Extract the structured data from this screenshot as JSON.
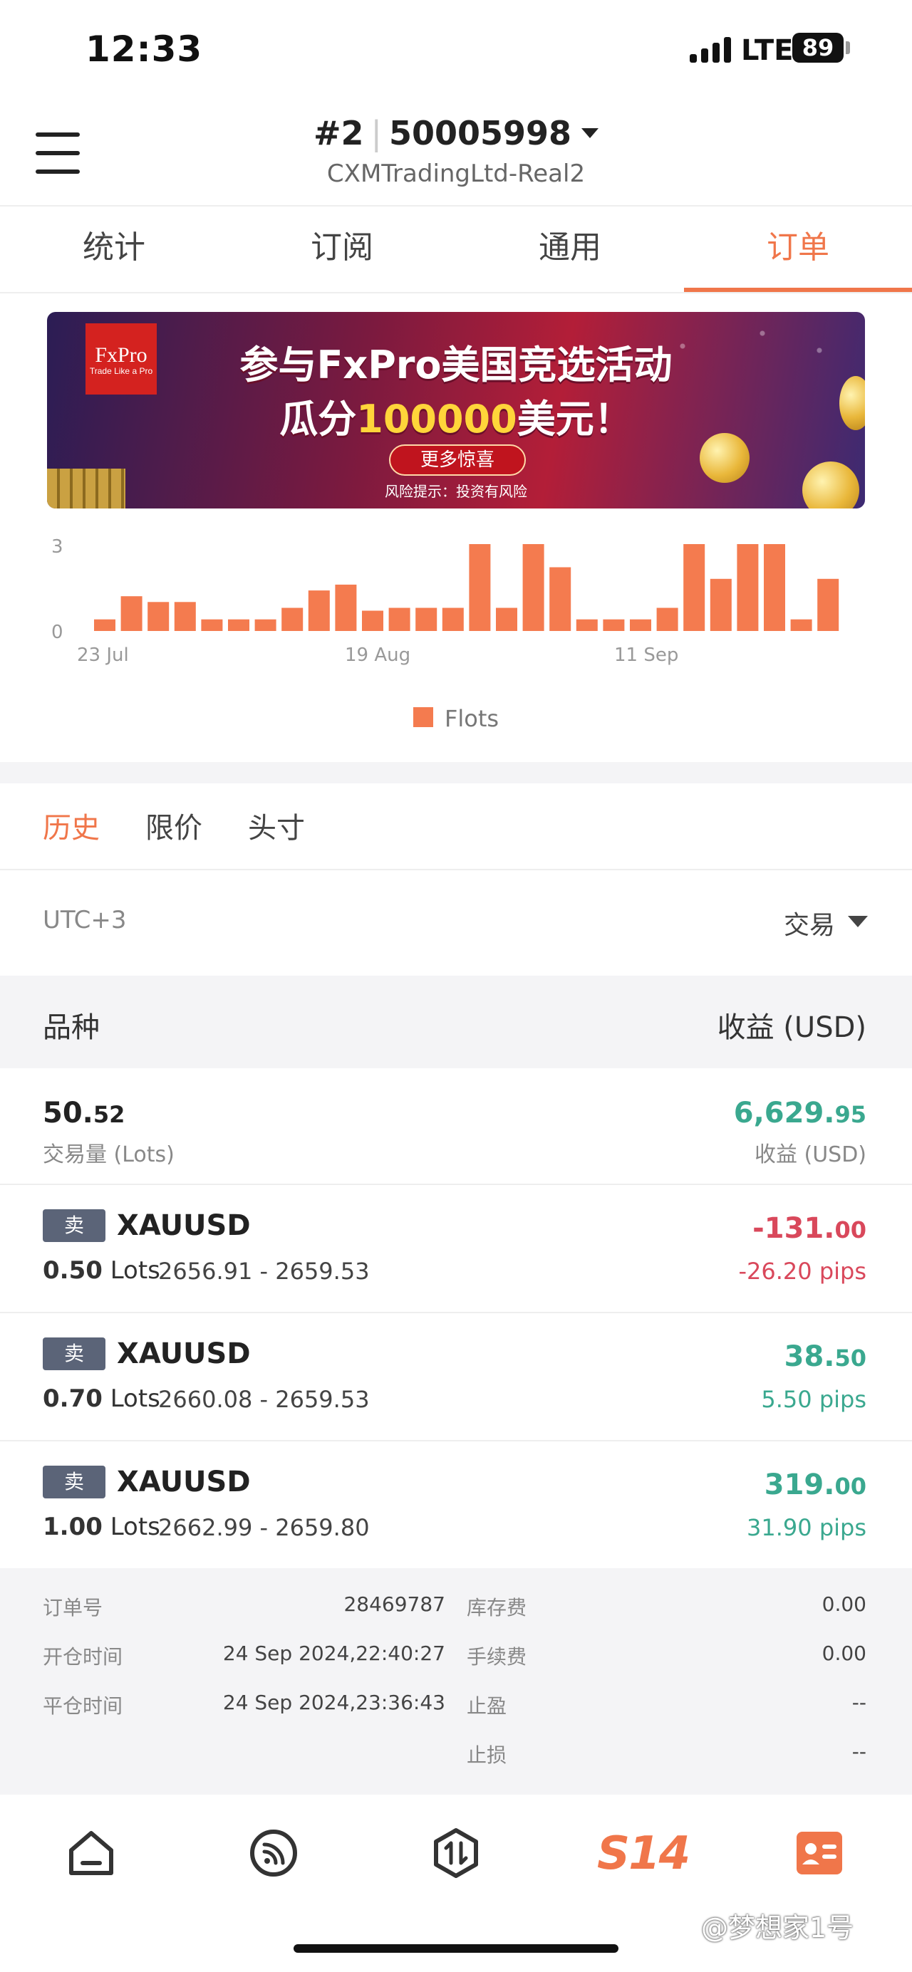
{
  "status_bar": {
    "time": "12:33",
    "network": "LTE",
    "battery": "89"
  },
  "header": {
    "account_index": "#2",
    "account_number": "50005998",
    "server": "CXMTradingLtd-Real2"
  },
  "tabs": [
    {
      "label": "统计"
    },
    {
      "label": "订阅"
    },
    {
      "label": "通用"
    },
    {
      "label": "订单"
    }
  ],
  "banner": {
    "logo": "FxPro",
    "logo_tagline": "Trade Like a Pro",
    "line1": "参与FxPro美国竞选活动",
    "line2_prefix": "瓜分",
    "line2_highlight": "100000",
    "line2_suffix": "美元！",
    "button": "更多惊喜",
    "risk": "风险提示：投资有风险"
  },
  "chart_data": {
    "type": "bar",
    "y_ticks": [
      "3",
      "0"
    ],
    "ylim": [
      0,
      3
    ],
    "x_ticks": [
      "23 Jul",
      "19 Aug",
      "11 Sep"
    ],
    "values": [
      0.4,
      1.2,
      1.0,
      1.0,
      0.4,
      0.4,
      0.4,
      0.8,
      1.4,
      1.6,
      0.7,
      0.8,
      0.8,
      0.8,
      3.0,
      0.8,
      3.0,
      2.2,
      0.4,
      0.4,
      0.4,
      0.8,
      3.0,
      1.8,
      3.0,
      3.0,
      0.4,
      1.8
    ],
    "series": [
      {
        "name": "Flots",
        "color": "#f47b4f"
      }
    ],
    "legend": "Flots"
  },
  "subtabs": [
    {
      "label": "历史"
    },
    {
      "label": "限价"
    },
    {
      "label": "头寸"
    }
  ],
  "filter": {
    "timezone": "UTC+3",
    "type": "交易"
  },
  "table_header": {
    "left": "品种",
    "right": "收益 (USD)"
  },
  "summary": {
    "volume_int": "50.",
    "volume_dec": "52",
    "volume_label": "交易量 (Lots)",
    "profit_int": "6,629.",
    "profit_dec": "95",
    "profit_label": "收益 (USD)"
  },
  "trades": [
    {
      "side": "卖",
      "symbol": "XAUUSD",
      "lots": "0.50",
      "lots_unit": "Lots",
      "prices": "2656.91 - 2659.53",
      "profit_int": "-131.",
      "profit_dec": "00",
      "pips": "-26.20 pips"
    },
    {
      "side": "卖",
      "symbol": "XAUUSD",
      "lots": "0.70",
      "lots_unit": "Lots",
      "prices": "2660.08 - 2659.53",
      "profit_int": "38.",
      "profit_dec": "50",
      "pips": "5.50 pips"
    },
    {
      "side": "卖",
      "symbol": "XAUUSD",
      "lots": "1.00",
      "lots_unit": "Lots",
      "prices": "2662.99 - 2659.80",
      "profit_int": "319.",
      "profit_dec": "00",
      "pips": "31.90 pips"
    }
  ],
  "details": {
    "order_no_label": "订单号",
    "order_no": "28469787",
    "open_time_label": "开仓时间",
    "open_time": "24 Sep 2024,22:40:27",
    "close_time_label": "平仓时间",
    "close_time": "24 Sep 2024,23:36:43",
    "swap_label": "库存费",
    "swap": "0.00",
    "commission_label": "手续费",
    "commission": "0.00",
    "tp_label": "止盈",
    "tp": "--",
    "sl_label": "止损",
    "sl": "--"
  },
  "bottom_nav": {
    "brand": "S14"
  },
  "watermark": "@梦想家1号",
  "colors": {
    "accent": "#f0764a",
    "profit_green": "#3aa88f",
    "loss_red": "#d9485b",
    "bar": "#f47b4f"
  }
}
